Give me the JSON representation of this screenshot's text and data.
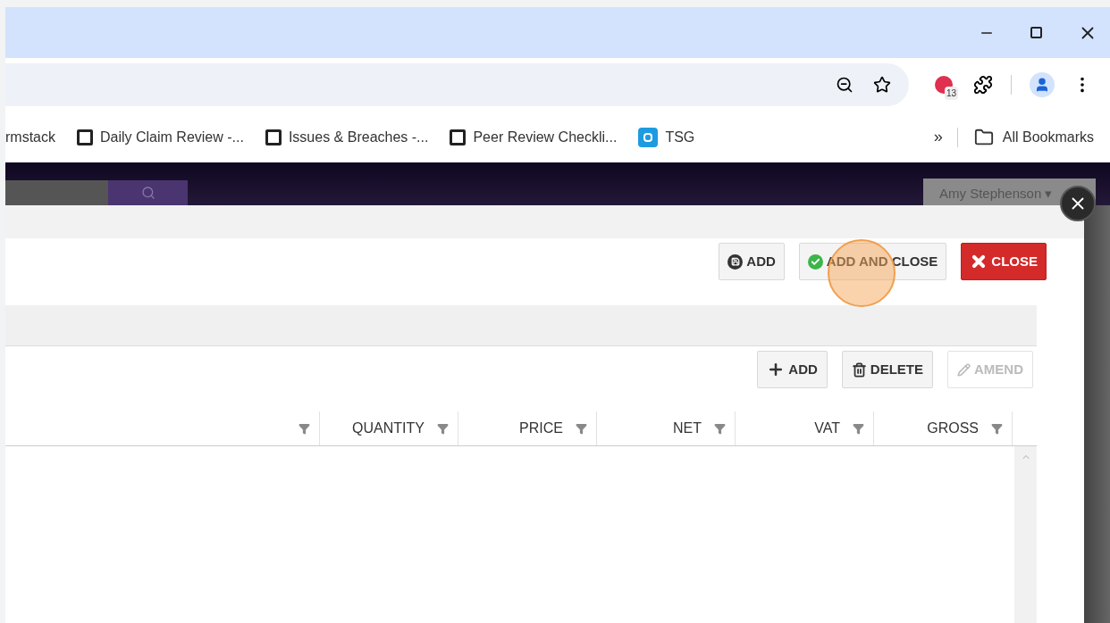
{
  "bookmarks": [
    {
      "label": "rmstack",
      "kind": "plain"
    },
    {
      "label": "Daily Claim Review -...",
      "kind": "doc"
    },
    {
      "label": "Issues & Breaches -...",
      "kind": "doc"
    },
    {
      "label": "Peer Review Checkli...",
      "kind": "doc"
    },
    {
      "label": "TSG",
      "kind": "app"
    }
  ],
  "bookmarks_overflow": "»",
  "all_bookmarks": "All Bookmarks",
  "extension_badge": "13",
  "user_menu": "Amy Stephenson ▾",
  "modal_actions": [
    {
      "label": "ADD",
      "kind": "save"
    },
    {
      "label": "ADD AND CLOSE",
      "kind": "confirm"
    },
    {
      "label": "CLOSE",
      "kind": "danger"
    }
  ],
  "grid_actions": [
    {
      "label": "ADD",
      "kind": "add",
      "disabled": false
    },
    {
      "label": "DELETE",
      "kind": "delete",
      "disabled": false
    },
    {
      "label": "AMEND",
      "kind": "edit",
      "disabled": true
    }
  ],
  "columns": [
    {},
    {
      "label": "QUANTITY"
    },
    {
      "label": "PRICE"
    },
    {
      "label": "NET"
    },
    {
      "label": "VAT"
    },
    {
      "label": "GROSS"
    }
  ]
}
